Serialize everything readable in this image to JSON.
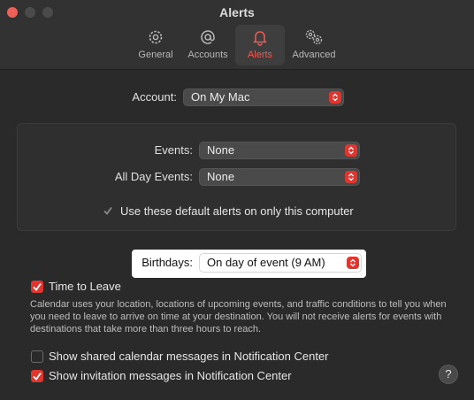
{
  "window": {
    "title": "Alerts"
  },
  "tabs": [
    {
      "label": "General",
      "icon": "gear-icon"
    },
    {
      "label": "Accounts",
      "icon": "at-icon"
    },
    {
      "label": "Alerts",
      "icon": "bell-icon"
    },
    {
      "label": "Advanced",
      "icon": "gears-icon"
    }
  ],
  "account": {
    "label": "Account:",
    "value": "On My Mac"
  },
  "events": {
    "label": "Events:",
    "value": "None"
  },
  "all_day_events": {
    "label": "All Day Events:",
    "value": "None"
  },
  "default_alerts_checkbox": {
    "label": "Use these default alerts on only this computer",
    "checked": true,
    "enabled": false
  },
  "birthdays": {
    "label": "Birthdays:",
    "value": "On day of event (9 AM)"
  },
  "time_to_leave": {
    "label": "Time to Leave",
    "checked": true,
    "description": "Calendar uses your location, locations of upcoming events, and traffic conditions to tell you when you need to leave to arrive on time at your destination. You will not receive alerts for events with destinations that take more than three hours to reach."
  },
  "shared_calendar_messages": {
    "label": "Show shared calendar messages in Notification Center",
    "checked": false
  },
  "invitation_messages": {
    "label": "Show invitation messages in Notification Center",
    "checked": true
  },
  "help": {
    "label": "?"
  },
  "colors": {
    "accent": "#e0362f",
    "highlight": "#ffffff",
    "background": "#2a2a2a"
  }
}
